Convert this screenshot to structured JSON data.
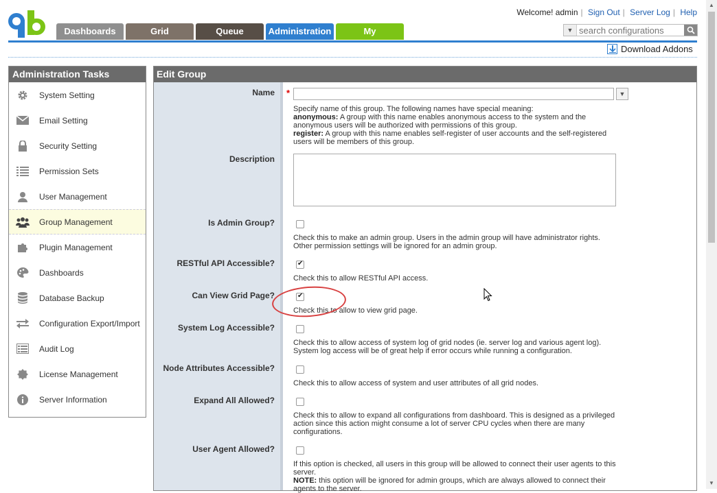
{
  "header": {
    "welcome": "Welcome! admin",
    "sign_out": "Sign Out",
    "server_log": "Server Log",
    "help": "Help",
    "search_placeholder": "search configurations",
    "download_addons": "Download Addons",
    "tabs": [
      "Dashboards",
      "Grid",
      "Queue",
      "Administration",
      "My"
    ],
    "active_tab": "Administration"
  },
  "sidebar": {
    "title": "Administration Tasks",
    "items": [
      {
        "label": "System Setting",
        "icon": "gear-icon"
      },
      {
        "label": "Email Setting",
        "icon": "envelope-icon"
      },
      {
        "label": "Security Setting",
        "icon": "lock-icon"
      },
      {
        "label": "Permission Sets",
        "icon": "list-icon"
      },
      {
        "label": "User Management",
        "icon": "user-icon"
      },
      {
        "label": "Group Management",
        "icon": "group-icon"
      },
      {
        "label": "Plugin Management",
        "icon": "puzzle-icon"
      },
      {
        "label": "Dashboards",
        "icon": "palette-icon"
      },
      {
        "label": "Database Backup",
        "icon": "database-icon"
      },
      {
        "label": "Configuration Export/Import",
        "icon": "arrows-icon"
      },
      {
        "label": "Audit Log",
        "icon": "log-icon"
      },
      {
        "label": "License Management",
        "icon": "badge-icon"
      },
      {
        "label": "Server Information",
        "icon": "info-icon"
      }
    ],
    "active": "Group Management"
  },
  "form": {
    "title": "Edit Group",
    "name_label": "Name",
    "name_value": "",
    "name_help_intro": "Specify name of this group. The following names have special meaning:",
    "name_help_anon_key": "anonymous:",
    "name_help_anon": "A group with this name enables anonymous access to the system and the anonymous users will be authorized with permissions of this group.",
    "name_help_reg_key": "register:",
    "name_help_reg": "A group with this name enables self-register of user accounts and the self-registered users will be members of this group.",
    "description_label": "Description",
    "description_value": "",
    "admin_label": "Is Admin Group?",
    "admin_checked": false,
    "admin_help": "Check this to make an admin group. Users in the admin group will have administrator rights. Other permission settings will be ignored for an admin group.",
    "restful_label": "RESTful API Accessible?",
    "restful_checked": true,
    "restful_help": "Check this to allow RESTful API access.",
    "grid_label": "Can View Grid Page?",
    "grid_checked": true,
    "grid_help": "Check this to allow to view grid page.",
    "syslog_label": "System Log Accessible?",
    "syslog_checked": false,
    "syslog_help": "Check this to allow access of system log of grid nodes (ie. server log and various agent log). System log access will be of great help if error occurs while running a configuration.",
    "nodeattr_label": "Node Attributes Accessible?",
    "nodeattr_checked": false,
    "nodeattr_help": "Check this to allow access of system and user attributes of all grid nodes.",
    "expand_label": "Expand All Allowed?",
    "expand_checked": false,
    "expand_help": "Check this to allow to expand all configurations from dashboard. This is designed as a privileged action since this action might consume a lot of server CPU cycles when there are many configurations.",
    "agent_label": "User Agent Allowed?",
    "agent_checked": false,
    "agent_help": "If this option is checked, all users in this group will be allowed to connect their user agents to this server.",
    "agent_note_key": "NOTE:",
    "agent_note": "this option will be ignored for admin groups, which are always allowed to connect their agents to the server."
  },
  "colors": {
    "accent_blue": "#2f7fcf",
    "tab_my": "#7cc416",
    "annotation_red": "#d84040"
  }
}
